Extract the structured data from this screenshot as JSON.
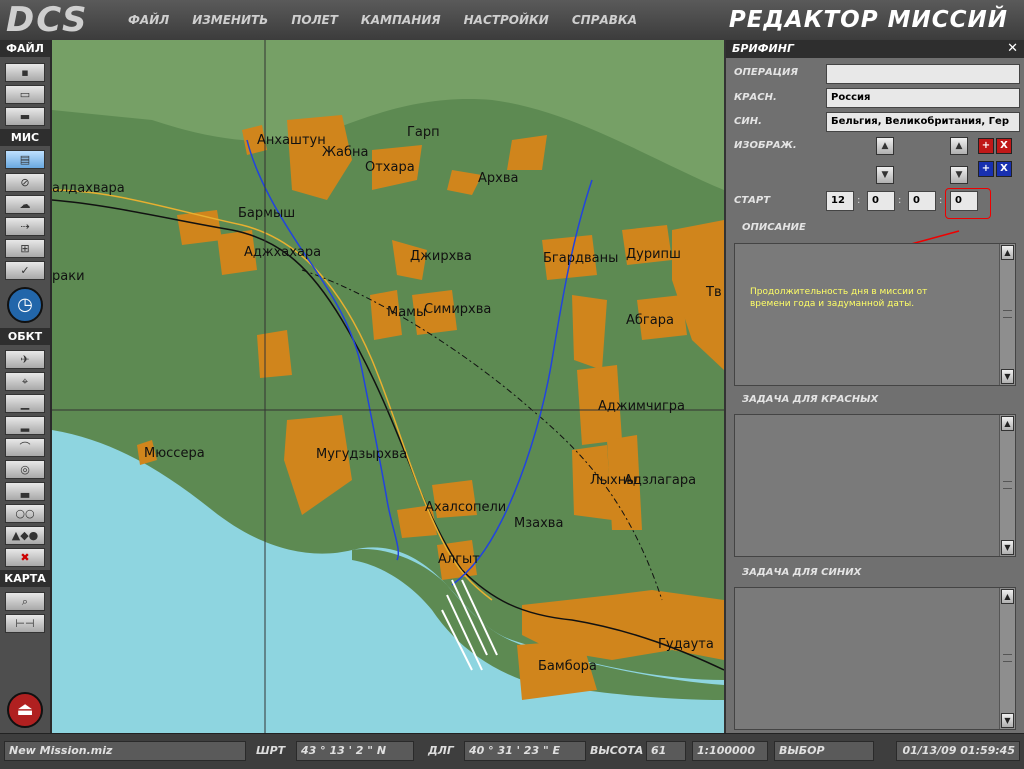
{
  "app": {
    "logo": "DCS",
    "title": "РЕДАКТОР МИССИЙ"
  },
  "menu": [
    "ФАЙЛ",
    "ИЗМЕНИТЬ",
    "ПОЛЕТ",
    "КАМПАНИЯ",
    "НАСТРОЙКИ",
    "СПРАВКА"
  ],
  "toolbar": {
    "file_header": "ФАЙЛ",
    "mission_header": "МИС",
    "objects_header": "ОБКТ",
    "map_header": "КАРТА",
    "icons": {
      "new": "new-file-icon",
      "open": "open-folder-icon",
      "save": "save-icon",
      "briefing": "briefing-icon",
      "failures": "failures-icon",
      "weather": "weather-icon",
      "triggers": "triggers-icon",
      "goals": "goals-icon",
      "check": "check-icon",
      "time": "clock-icon",
      "plane": "plane-icon",
      "helicopter": "helicopter-icon",
      "ship": "ship-icon",
      "vehicle": "vehicle-icon",
      "bridge": "bridge-icon",
      "target": "target-icon",
      "static": "static-object-icon",
      "group": "group-icon",
      "shapes": "shapes-icon",
      "delete": "delete-icon",
      "zoom": "zoom-icon",
      "ruler": "ruler-icon",
      "exit": "exit-icon"
    }
  },
  "map": {
    "labels": [
      "Анхаштун",
      "Гарп",
      "Жабна",
      "Отхара",
      "Архва",
      "алдахвара",
      "Бармыш",
      "Аджхахара",
      "Джирхва",
      "Бгардваны",
      "Дурипш",
      "Тв",
      "раки",
      "Мамы",
      "Симирхва",
      "Абгара",
      "Аджимчигра",
      "Мюссера",
      "Мугудзырхва",
      "Лыхны",
      "Адзлагара",
      "Ахалсопели",
      "Мзахва",
      "Алгыт",
      "Гудаута",
      "Бамбора"
    ]
  },
  "briefing": {
    "title": "БРИФИНГ",
    "close": "✕",
    "operation_label": "ОПЕРАЦИЯ",
    "operation_value": "",
    "red_label": "КРАСН.",
    "red_value": "Россия",
    "blue_label": "СИН.",
    "blue_value": "Бельгия, Великобритания, Гер",
    "image_label": "ИЗОБРАЖ.",
    "start_label": "СТАРТ",
    "start_time": [
      "12",
      "0",
      "0",
      "0"
    ],
    "description_label": "ОПИСАНИЕ",
    "annotation": "Продолжительность дня в миссии от времени года и задуманной даты.",
    "red_task_label": "ЗАДАЧА ДЛЯ КРАСНЫХ",
    "blue_task_label": "ЗАДАЧА ДЛЯ СИНИХ",
    "colors": {
      "red_btn": "#c01818",
      "blue_btn": "#1830b0",
      "annotation": "#ffff66",
      "highlight": "#e00000"
    }
  },
  "status": {
    "filename": "New Mission.miz",
    "lat_label": "ШРТ",
    "lat_value": "43 ° 13 ' 2 \" N",
    "lon_label": "ДЛГ",
    "lon_value": "40 ° 31 ' 23 \" E",
    "alt_label": "ВЫСОТА",
    "alt_value": "61",
    "scale": "1:100000",
    "mode": "ВЫБОР",
    "datetime": "01/13/09 01:59:45"
  }
}
